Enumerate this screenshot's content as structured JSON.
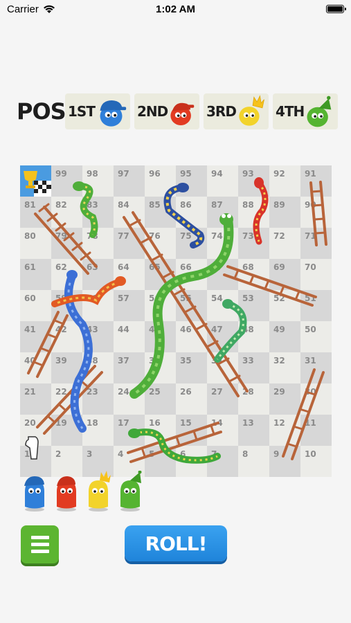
{
  "status": {
    "carrier": "Carrier",
    "time": "1:02 AM"
  },
  "header": {
    "pos_label": "POS",
    "ranks": [
      {
        "label": "1ST",
        "color": "#2f7fd9",
        "accessory": "blue-cap"
      },
      {
        "label": "2ND",
        "color": "#e23b22",
        "accessory": "red-cap"
      },
      {
        "label": "3RD",
        "color": "#f2d32b",
        "accessory": "gold-crown"
      },
      {
        "label": "4TH",
        "color": "#55b431",
        "accessory": "green-party-hat"
      }
    ]
  },
  "board": {
    "rows": [
      [
        "",
        "99",
        "98",
        "97",
        "96",
        "95",
        "94",
        "93",
        "92",
        "91"
      ],
      [
        "81",
        "82",
        "83",
        "84",
        "85",
        "86",
        "87",
        "88",
        "89",
        "90"
      ],
      [
        "80",
        "79",
        "78",
        "77",
        "76",
        "75",
        "74",
        "73",
        "72",
        "71"
      ],
      [
        "61",
        "62",
        "63",
        "64",
        "65",
        "66",
        "67",
        "68",
        "69",
        "70"
      ],
      [
        "60",
        "59",
        "58",
        "57",
        "56",
        "55",
        "54",
        "53",
        "52",
        "51"
      ],
      [
        "41",
        "42",
        "43",
        "44",
        "45",
        "46",
        "47",
        "48",
        "49",
        "50"
      ],
      [
        "40",
        "39",
        "38",
        "37",
        "36",
        "35",
        "34",
        "33",
        "32",
        "31"
      ],
      [
        "21",
        "22",
        "23",
        "24",
        "25",
        "26",
        "27",
        "28",
        "29",
        "30"
      ],
      [
        "20",
        "19",
        "18",
        "17",
        "16",
        "15",
        "14",
        "13",
        "12",
        "11"
      ],
      [
        "1",
        "2",
        "3",
        "4",
        "5",
        "6",
        "7",
        "8",
        "9",
        "10"
      ]
    ]
  },
  "players": [
    {
      "color": "#2f7fd9",
      "accessory": "blue-cap"
    },
    {
      "color": "#e23b22",
      "accessory": "red-cap"
    },
    {
      "color": "#f2d32b",
      "accessory": "gold-crown"
    },
    {
      "color": "#55b431",
      "accessory": "green-party-hat"
    }
  ],
  "controls": {
    "roll_label": "ROLL!",
    "menu_icon": "hamburger-icon"
  }
}
